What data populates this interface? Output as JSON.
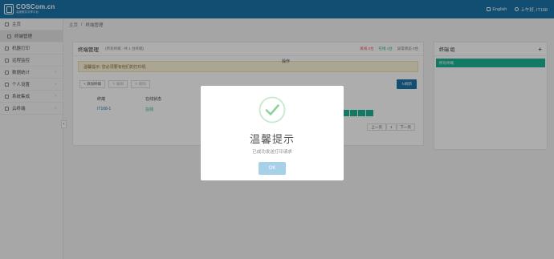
{
  "header": {
    "logo_name": "COSCom.cn",
    "logo_sub": "高速服务共享平台",
    "language": "English",
    "user": "上午好, IT168"
  },
  "sidebar": {
    "items": [
      {
        "label": "主页",
        "icon": "home-icon"
      },
      {
        "label": "终端管理",
        "icon": "monitor-icon"
      },
      {
        "label": "机器打印",
        "icon": "printer-icon"
      },
      {
        "label": "远程监控",
        "icon": "monitor-icon"
      },
      {
        "label": "数据统计",
        "icon": "chart-icon"
      },
      {
        "label": "个人设置",
        "icon": "user-icon"
      },
      {
        "label": "系统集成",
        "icon": "settings-icon"
      },
      {
        "label": "云终端",
        "icon": "cloud-icon"
      }
    ],
    "collapse": "‹"
  },
  "breadcrumb": {
    "home": "主页",
    "sep": "/",
    "current": "终端管理"
  },
  "panel": {
    "title": "终端管理",
    "note": "(所有终端 - 共 1 台终端)",
    "stats": {
      "offline": "离线 0台",
      "online": "在线 1台",
      "abnormal": "异常状态 0台"
    },
    "alert": "温馨提示: 您必须要有他们的打印机",
    "buttons": {
      "add": "+ 添加终端",
      "edit": "✎ 编辑",
      "delete": "✕ 删除",
      "refresh": "↻刷新"
    },
    "headers": {
      "terminal": "终端",
      "status": "在线状态",
      "ops": "操作"
    },
    "rows": [
      {
        "terminal": "IT168-1",
        "status": "在线"
      }
    ],
    "pager": {
      "prev": "上一页",
      "page": "1",
      "next": "下一页"
    }
  },
  "rpanel": {
    "title": "终端 组",
    "plus": "+",
    "item": "所有终端"
  },
  "modal": {
    "title": "温馨提示",
    "text": "已成功发送打印请求",
    "ok": "OK"
  },
  "colors": {
    "primary": "#1b74a8",
    "success": "#1ab394",
    "ok_button": "#a6d1e9"
  }
}
